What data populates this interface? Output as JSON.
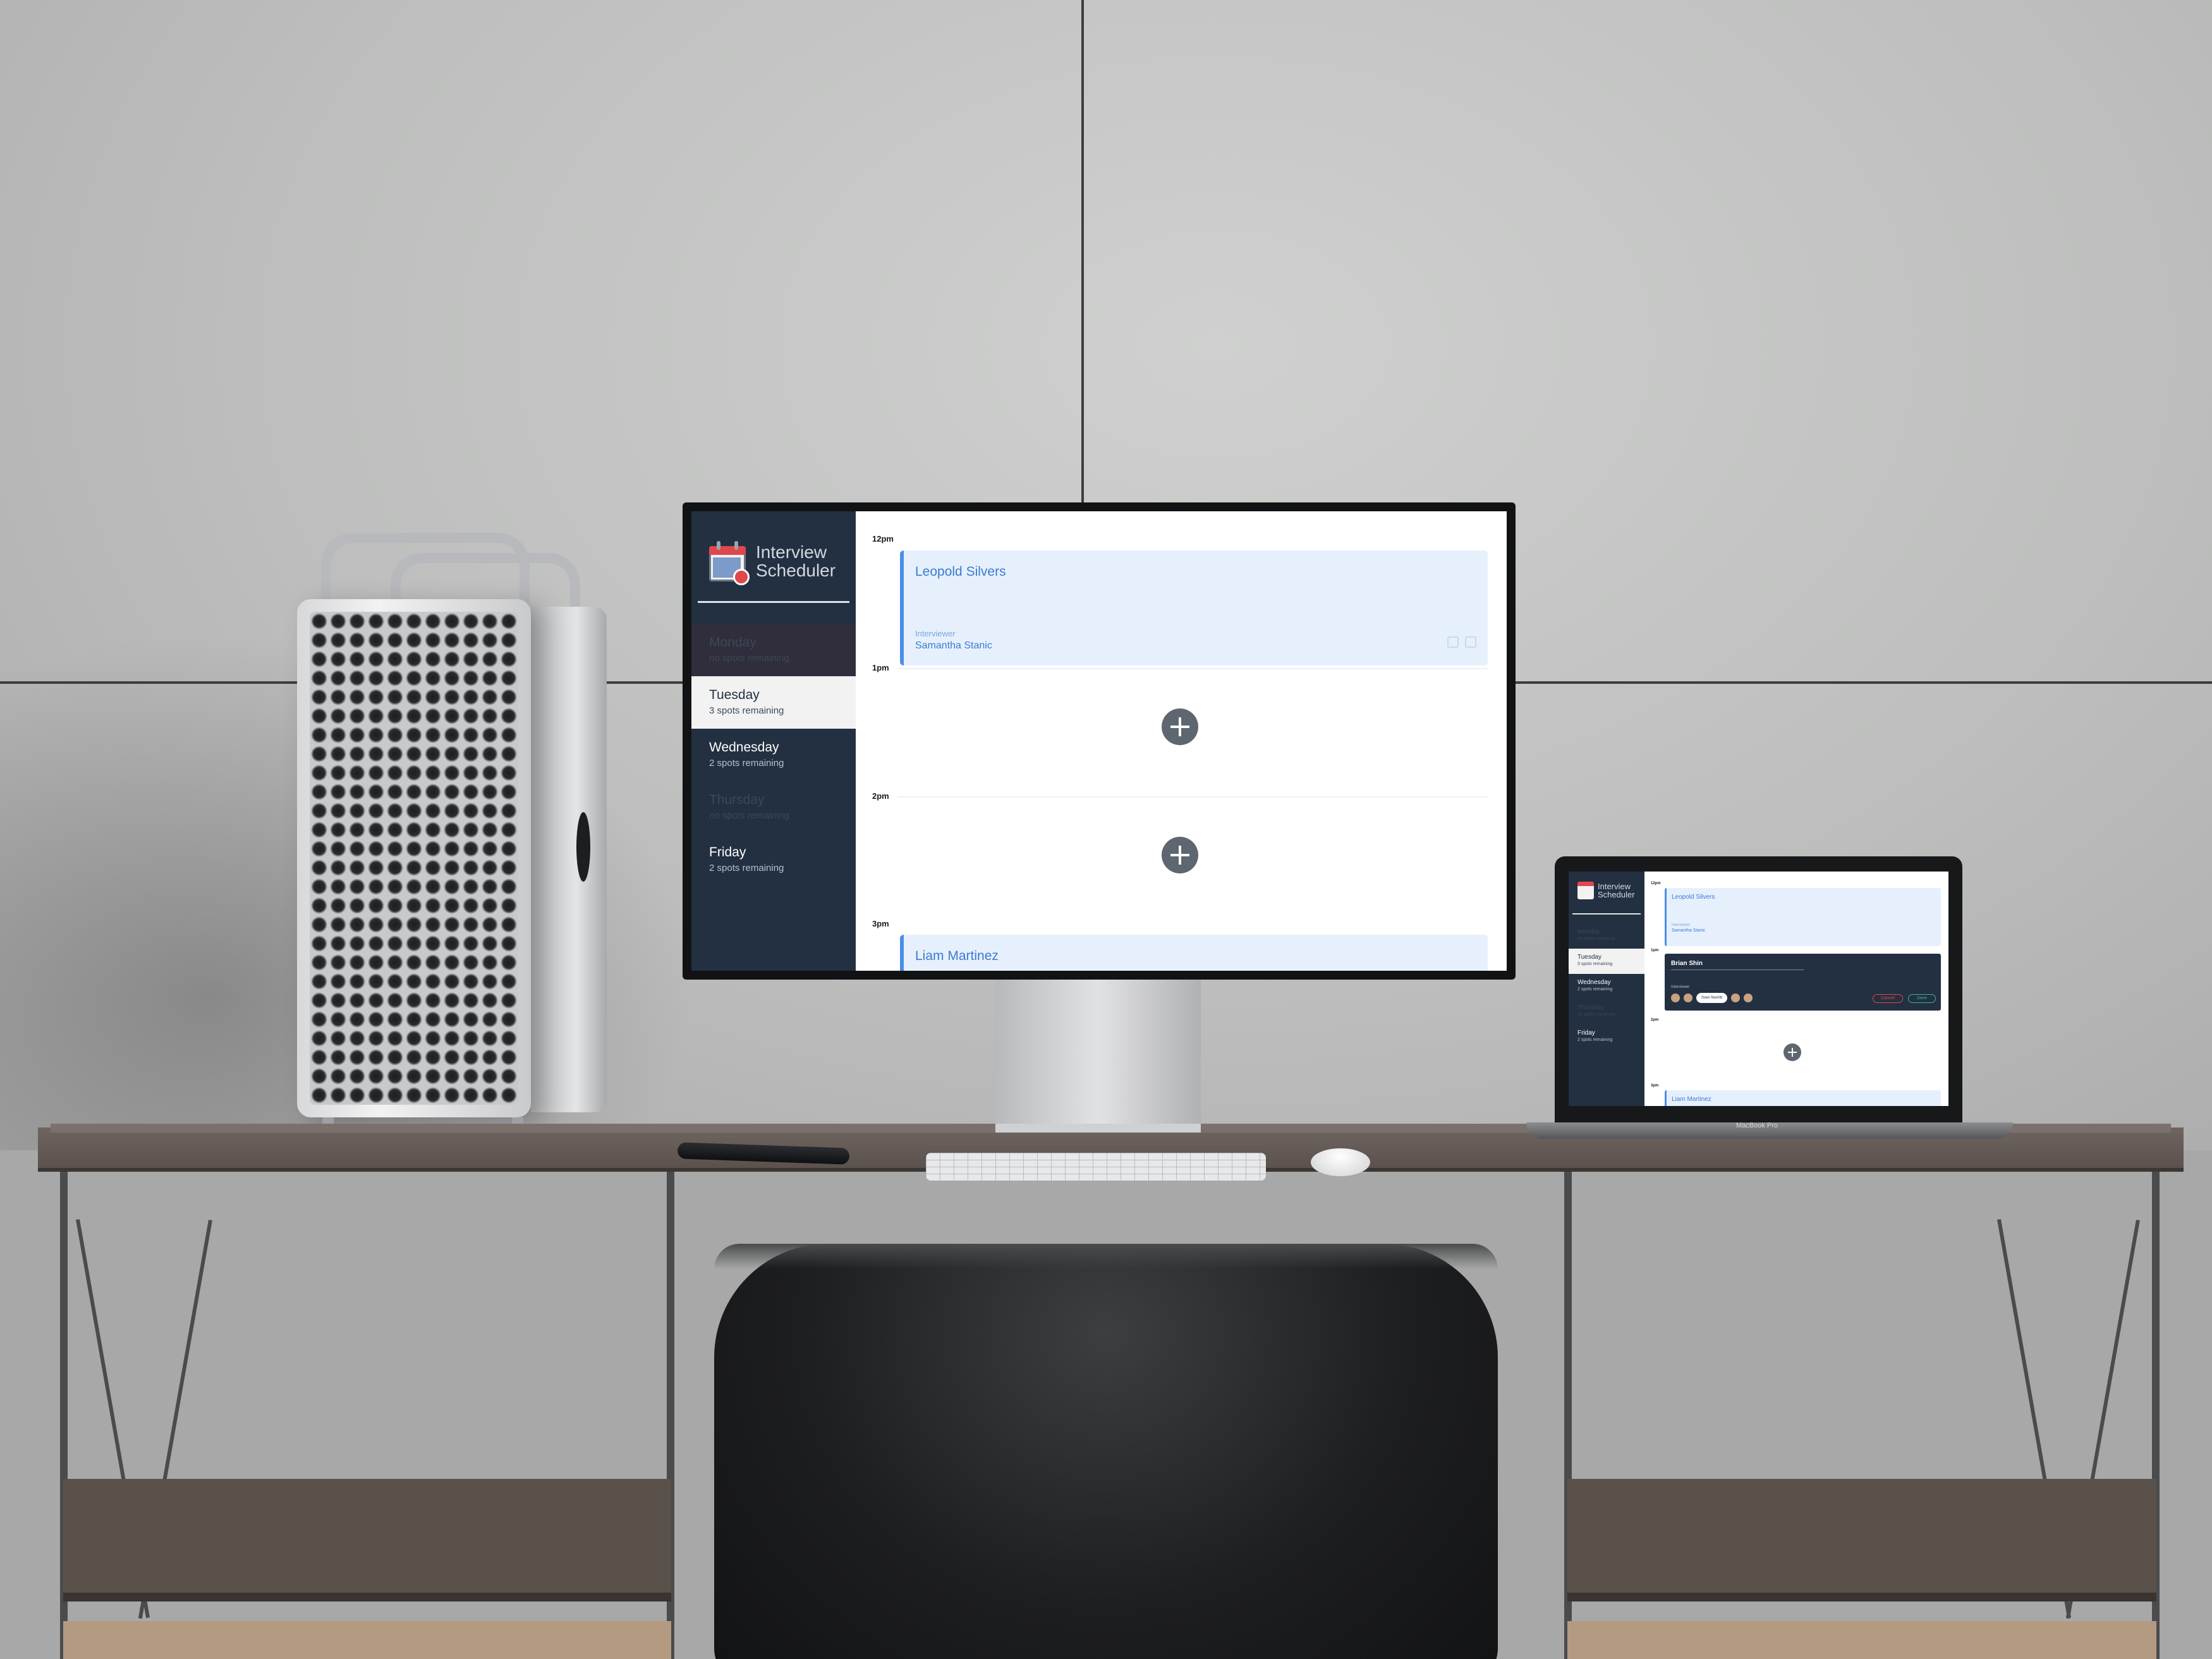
{
  "monitor_app": {
    "title_line1": "Interview",
    "title_line2": "Scheduler",
    "days": [
      {
        "name": "Monday",
        "spots": "no spots remaining"
      },
      {
        "name": "Tuesday",
        "spots": "3 spots remaining"
      },
      {
        "name": "Wednesday",
        "spots": "2 spots remaining"
      },
      {
        "name": "Thursday",
        "spots": "no spots remaining"
      },
      {
        "name": "Friday",
        "spots": "2 spots remaining"
      }
    ],
    "times": [
      "12pm",
      "1pm",
      "2pm",
      "3pm"
    ],
    "appointments": [
      {
        "student": "Leopold Silvers",
        "role_label": "Interviewer",
        "interviewer": "Samantha Stanic"
      },
      {
        "student": "Liam Martinez"
      }
    ]
  },
  "laptop_app": {
    "title_line1": "Interview",
    "title_line2": "Scheduler",
    "days": [
      {
        "name": "Monday",
        "spots": "no spots remaining"
      },
      {
        "name": "Tuesday",
        "spots": "3 spots remaining"
      },
      {
        "name": "Wednesday",
        "spots": "2 spots remaining"
      },
      {
        "name": "Thursday",
        "spots": "no spots remaining"
      },
      {
        "name": "Friday",
        "spots": "2 spots remaining"
      }
    ],
    "times": [
      "12pm",
      "1pm",
      "2pm",
      "3pm"
    ],
    "appointment": {
      "student": "Leopold Silvers",
      "role_label": "Interviewer",
      "interviewer": "Samantha Stanic"
    },
    "form": {
      "student_value": "Brian Shin",
      "interviewer_label": "Interviewer",
      "selected_interviewer": "Sven Norrlitt",
      "cancel_label": "Cancel",
      "save_label": "Save"
    },
    "next_appointment": {
      "student": "Liam Martinez"
    },
    "brand": "MacBook Pro"
  },
  "colors": {
    "sidebar": "#223041",
    "accent": "#4a8ee6",
    "appointment_bg": "#e6f0fd",
    "add_button": "#5e6670",
    "danger": "#e0474c",
    "success": "#3fb58a"
  }
}
